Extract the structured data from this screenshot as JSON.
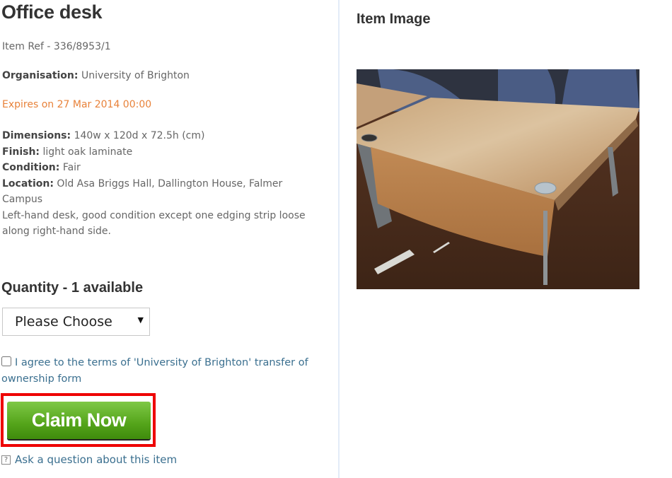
{
  "item": {
    "title": "Office desk",
    "ref": "Item Ref - 336/8953/1",
    "organisation_label": "Organisation:",
    "organisation": "University of Brighton",
    "expires": "Expires on 27 Mar 2014 00:00",
    "specs": [
      {
        "label": "Dimensions:",
        "value": "140w x 120d x 72.5h (cm)"
      },
      {
        "label": "Finish:",
        "value": "light oak laminate"
      },
      {
        "label": "Condition:",
        "value": "Fair"
      },
      {
        "label": "Location:",
        "value": "Old Asa Briggs Hall, Dallington House, Falmer Campus"
      }
    ],
    "description": "Left-hand desk, good condition except one edging strip loose along right-hand side."
  },
  "quantity": {
    "heading": "Quantity - 1 available",
    "selected": "Please Choose",
    "arrow": "▼"
  },
  "terms": {
    "text": "I agree to the terms of 'University of Brighton' transfer of ownership form",
    "checked": false
  },
  "actions": {
    "claim_label": "Claim Now",
    "ask_label": "Ask a question about this item",
    "help_glyph": "?"
  },
  "image_panel": {
    "heading": "Item Image",
    "alt": "Photo of a light oak office desk with blue chairs behind it"
  },
  "colors": {
    "expires": "#e8823a",
    "claim_button": "#54a41a",
    "highlight_outline": "#ee0000",
    "link": "#3a6f8f"
  }
}
